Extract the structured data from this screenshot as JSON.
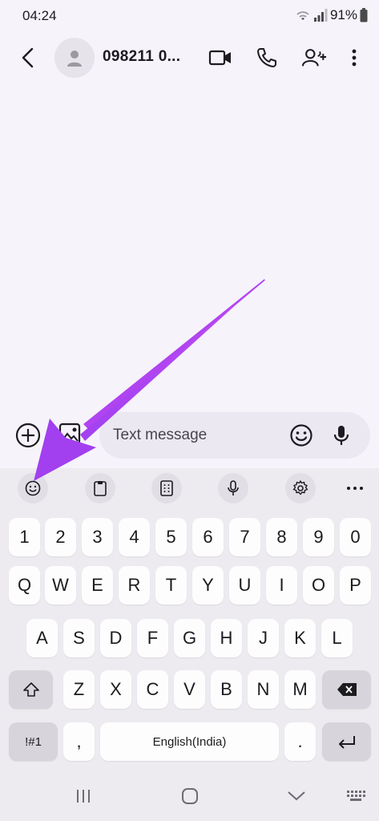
{
  "status_bar": {
    "time": "04:24",
    "battery": "91%"
  },
  "header": {
    "contact_name": "098211 0..."
  },
  "compose": {
    "placeholder": "Text message"
  },
  "keyboard": {
    "number_row": [
      "1",
      "2",
      "3",
      "4",
      "5",
      "6",
      "7",
      "8",
      "9",
      "0"
    ],
    "row1": [
      "Q",
      "W",
      "E",
      "R",
      "T",
      "Y",
      "U",
      "I",
      "O",
      "P"
    ],
    "row2": [
      "A",
      "S",
      "D",
      "F",
      "G",
      "H",
      "J",
      "K",
      "L"
    ],
    "row3": [
      "Z",
      "X",
      "C",
      "V",
      "B",
      "N",
      "M"
    ],
    "symbols_label": "!#1",
    "comma": ",",
    "space_label": "English(India)",
    "period": "."
  },
  "colors": {
    "accent_arrow": "#b044f0",
    "background": "#f6f3fb",
    "keyboard_bg": "#edebf0"
  }
}
